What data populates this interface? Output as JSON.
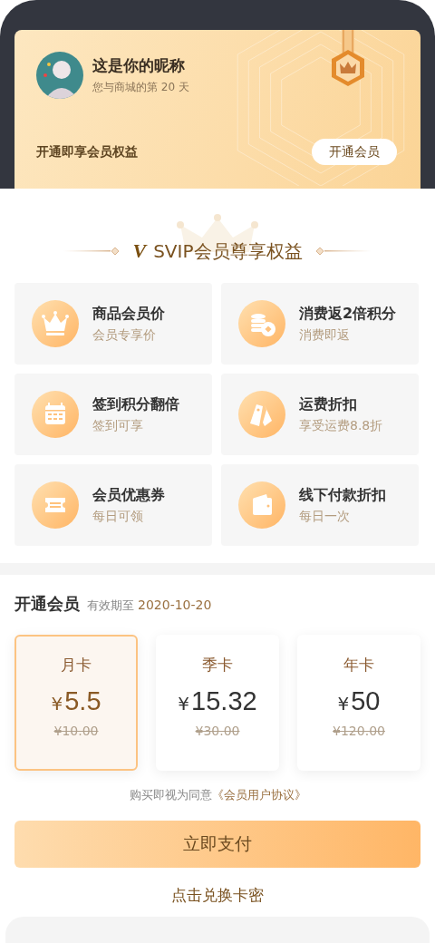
{
  "profile": {
    "nickname": "这是你的昵称",
    "days_text": "您与商城的第 20 天",
    "promo": "开通即享会员权益",
    "open_button": "开通会员"
  },
  "benefits_header": {
    "logo": "V",
    "title": "SVIP会员尊享权益"
  },
  "benefits": [
    {
      "title": "商品会员价",
      "subtitle": "会员专享价"
    },
    {
      "title": "消费返2倍积分",
      "subtitle": "消费即返"
    },
    {
      "title": "签到积分翻倍",
      "subtitle": "签到可享"
    },
    {
      "title": "运费折扣",
      "subtitle": "享受运费8.8折"
    },
    {
      "title": "会员优惠券",
      "subtitle": "每日可领"
    },
    {
      "title": "线下付款折扣",
      "subtitle": "每日一次"
    }
  ],
  "subscribe": {
    "title": "开通会员",
    "validity_label": "有效期至",
    "validity_date": "2020-10-20"
  },
  "plans": [
    {
      "name": "月卡",
      "currency": "¥",
      "price": "5.5",
      "original_price": "¥10.00",
      "selected": true
    },
    {
      "name": "季卡",
      "currency": "¥",
      "price": "15.32",
      "original_price": "¥30.00",
      "selected": false
    },
    {
      "name": "年卡",
      "currency": "¥",
      "price": "50",
      "original_price": "¥120.00",
      "selected": false
    }
  ],
  "agreement": {
    "text": "购买即视为同意",
    "link": "《会员用户协议》"
  },
  "pay_button": "立即支付",
  "redeem_link": "点击兑换卡密"
}
